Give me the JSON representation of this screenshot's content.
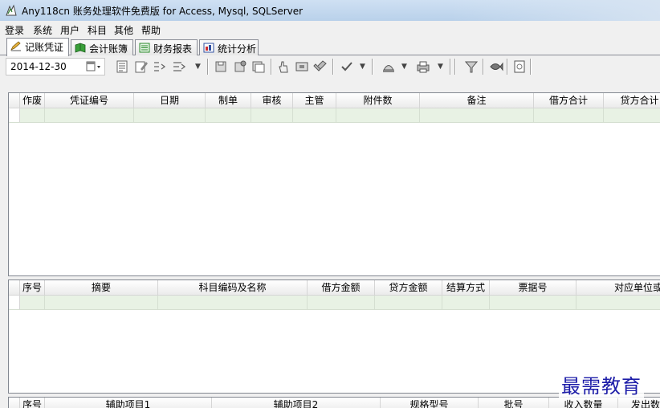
{
  "window": {
    "title": "Any118cn 账务处理软件免费版 for Access, Mysql, SQLServer"
  },
  "menu": [
    {
      "label": "登录"
    },
    {
      "label": "系统"
    },
    {
      "label": "用户"
    },
    {
      "label": "科目"
    },
    {
      "label": "其他"
    },
    {
      "label": "帮助"
    }
  ],
  "tabs": [
    {
      "label": "记账凭证",
      "active": true
    },
    {
      "label": "会计账簿",
      "active": false
    },
    {
      "label": "财务报表",
      "active": false
    },
    {
      "label": "统计分析",
      "active": false
    }
  ],
  "toolbar": {
    "date": "2014-12-30",
    "icons": [
      "calendar-icon",
      "voucher-list-icon",
      "edit-icon",
      "indent-icon",
      "outdent-icon",
      "save-icon",
      "save-as-icon",
      "save-copy-icon",
      "hand-pointer-icon",
      "delete-icon",
      "eraser-icon",
      "checkmark-icon",
      "stamp-icon",
      "printer-icon",
      "filter-icon",
      "fish-icon",
      "page-icon"
    ]
  },
  "voucher_grid": {
    "columns": [
      "作废",
      "凭证编号",
      "日期",
      "制单",
      "审核",
      "主管",
      "附件数",
      "备注",
      "借方合计",
      "贷方合计"
    ]
  },
  "entry_grid": {
    "columns": [
      "序号",
      "摘要",
      "科目编码及名称",
      "借方金额",
      "贷方金额",
      "结算方式",
      "票据号",
      "对应单位或"
    ]
  },
  "aux_grid": {
    "columns": [
      "序号",
      "辅助项目1",
      "辅助项目2",
      "规格型号",
      "批号",
      "收入数量",
      "发出数"
    ]
  },
  "watermark": "最需教育",
  "colors": {
    "row_highlight": "#e8f2e4",
    "title_bar": "#b9d1ea",
    "watermark": "#1c1ca8"
  }
}
